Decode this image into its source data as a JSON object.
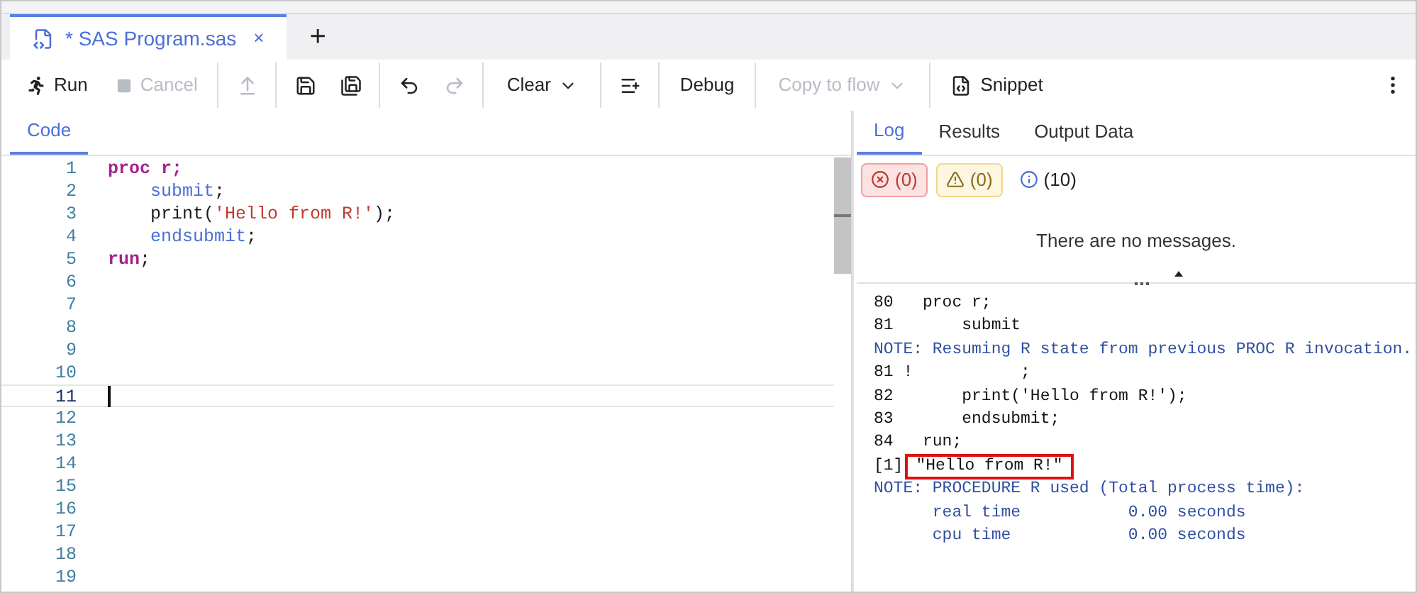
{
  "tabs": [
    {
      "label": "* SAS Program.sas",
      "selected": true,
      "close": "×"
    }
  ],
  "new_tab": "+",
  "toolbar": {
    "groups": [
      [
        {
          "kind": "labeled",
          "label": "Run",
          "disabled": false
        },
        {
          "kind": "labeled",
          "label": "Cancel",
          "disabled": true
        }
      ],
      [
        {
          "kind": "icon",
          "disabled": true
        }
      ],
      [
        {
          "kind": "icon",
          "disabled": false
        },
        {
          "kind": "icon",
          "disabled": false
        }
      ],
      [
        {
          "kind": "icon",
          "disabled": false
        },
        {
          "kind": "icon",
          "disabled": true
        }
      ],
      [
        {
          "kind": "dropdown",
          "label": "Clear",
          "disabled": false
        }
      ],
      [
        {
          "kind": "icon",
          "disabled": false
        }
      ],
      [
        {
          "kind": "labeled",
          "label": "Debug",
          "disabled": false
        }
      ],
      [
        {
          "kind": "dropdown",
          "label": "Copy to flow",
          "disabled": true
        }
      ],
      [
        {
          "kind": "labeled",
          "label": "Snippet",
          "disabled": false
        }
      ]
    ]
  },
  "editor": {
    "tabs": [
      {
        "label": "Code",
        "selected": true
      }
    ],
    "lines": [
      {
        "number": "1",
        "current": false,
        "tokens": [
          {
            "kind": "keyword",
            "text": "proc r;"
          }
        ]
      },
      {
        "number": "2",
        "current": false,
        "tokens": [
          {
            "kind": "statement",
            "text": "    submit"
          },
          {
            "kind": "plain",
            "text": ";"
          }
        ]
      },
      {
        "number": "3",
        "current": false,
        "tokens": [
          {
            "kind": "plain",
            "text": "    print("
          },
          {
            "kind": "string",
            "text": "'Hello from R!'"
          },
          {
            "kind": "plain",
            "text": ");"
          }
        ]
      },
      {
        "number": "4",
        "current": false,
        "tokens": [
          {
            "kind": "statement",
            "text": "    endsubmit"
          },
          {
            "kind": "plain",
            "text": ";"
          }
        ]
      },
      {
        "number": "5",
        "current": false,
        "tokens": [
          {
            "kind": "keyword",
            "text": "run"
          },
          {
            "kind": "plain",
            "text": ";"
          }
        ]
      },
      {
        "number": "6",
        "current": false
      },
      {
        "number": "7",
        "current": false
      },
      {
        "number": "8",
        "current": false
      },
      {
        "number": "9",
        "current": false
      },
      {
        "number": "10",
        "current": false
      },
      {
        "number": "11",
        "current": true
      },
      {
        "number": "12",
        "current": false
      },
      {
        "number": "13",
        "current": false
      },
      {
        "number": "14",
        "current": false
      },
      {
        "number": "15",
        "current": false
      },
      {
        "number": "16",
        "current": false
      },
      {
        "number": "17",
        "current": false
      },
      {
        "number": "18",
        "current": false
      },
      {
        "number": "19",
        "current": false
      }
    ]
  },
  "output": {
    "tabs": [
      {
        "label": "Log",
        "selected": true
      },
      {
        "label": "Results",
        "selected": false
      },
      {
        "label": "Output Data",
        "selected": false
      }
    ],
    "filters": [
      {
        "kind": "error",
        "count": "(0)"
      },
      {
        "kind": "warning",
        "count": "(0)"
      },
      {
        "kind": "info",
        "count": "(10)"
      }
    ],
    "messages_empty": "There are no messages.",
    "log": [
      {
        "kind": "source",
        "text": "80   proc r;"
      },
      {
        "kind": "source",
        "text": "81       submit"
      },
      {
        "kind": "note",
        "text": "NOTE: Resuming R state from previous PROC R invocation."
      },
      {
        "kind": "source",
        "text": "81 !           ;"
      },
      {
        "kind": "source",
        "text": "82       print('Hello from R!');"
      },
      {
        "kind": "source",
        "text": "83       endsubmit;"
      },
      {
        "kind": "source",
        "text": "84   run;"
      },
      {
        "kind": "output",
        "text": "[1]",
        "highlight": "\"Hello from R!\""
      },
      {
        "kind": "note",
        "text": "NOTE: PROCEDURE R used (Total process time):"
      },
      {
        "kind": "note",
        "text": "      real time           0.00 seconds"
      },
      {
        "kind": "note",
        "text": "      cpu time            0.00 seconds"
      }
    ]
  }
}
